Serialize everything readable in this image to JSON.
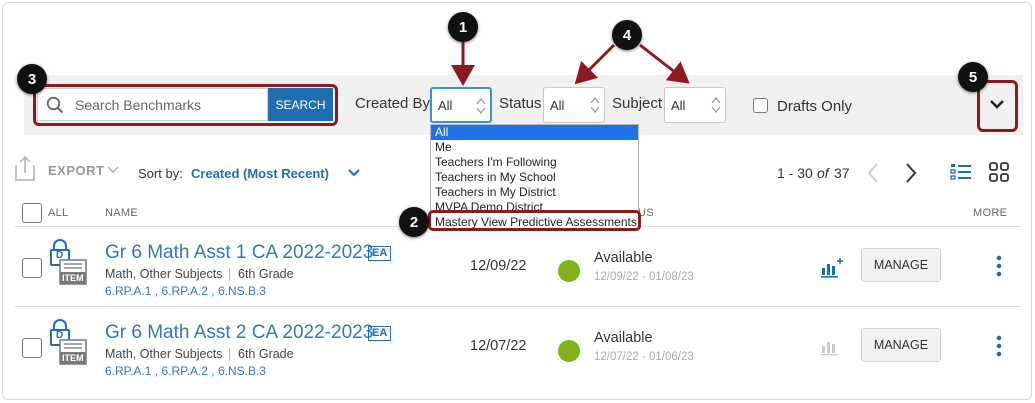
{
  "search": {
    "placeholder": "Search Benchmarks",
    "button_label": "SEARCH"
  },
  "filters": {
    "created_by": {
      "label": "Created By",
      "value": "All"
    },
    "status": {
      "label": "Status",
      "value": "All"
    },
    "subject": {
      "label": "Subject",
      "value": "All"
    },
    "drafts_only_label": "Drafts Only"
  },
  "created_by_options": [
    "All",
    "Me",
    "Teachers I'm Following",
    "Teachers in My School",
    "Teachers in My District",
    "MVPA Demo District",
    "Mastery View Predictive Assessments"
  ],
  "callouts": [
    "1",
    "2",
    "3",
    "4",
    "5"
  ],
  "toolbar": {
    "export_label": "EXPORT",
    "sort_prefix": "Sort by:",
    "sort_value": "Created (Most Recent)",
    "pagination_range": "1 - 30",
    "pagination_of": "of",
    "pagination_total": "37"
  },
  "columns": {
    "all": "ALL",
    "name": "NAME",
    "status": "US",
    "more": "MORE"
  },
  "rows": [
    {
      "title": "Gr 6 Math Asst 1 CA 2022-2023",
      "badge": "EA",
      "subjects": "Math, Other Subjects",
      "grade": "6th Grade",
      "standards": "6.RP.A.1 , 6.RP.A.2 , 6.NS.B.3",
      "date": "12/09/22",
      "status": "Available",
      "status_range": "12/09/22 - 01/08/23",
      "manage_label": "MANAGE",
      "status_color": "#7fb11a"
    },
    {
      "title": "Gr 6 Math Asst 2 CA 2022-2023",
      "badge": "EA",
      "subjects": "Math, Other Subjects",
      "grade": "6th Grade",
      "standards": "6.RP.A.1 , 6.RP.A.2 , 6.NS.B.3",
      "date": "12/07/22",
      "status": "Available",
      "status_range": "12/07/22 - 01/06/23",
      "manage_label": "MANAGE",
      "status_color": "#7fb11a"
    }
  ],
  "item_icon_label": "ITEM",
  "item_icon_letter": "D",
  "colors": {
    "accent": "#1f6fb0",
    "annotation": "#8d1a1f",
    "status_available": "#7fb11a",
    "dropdown_selected": "#1e73e8"
  }
}
